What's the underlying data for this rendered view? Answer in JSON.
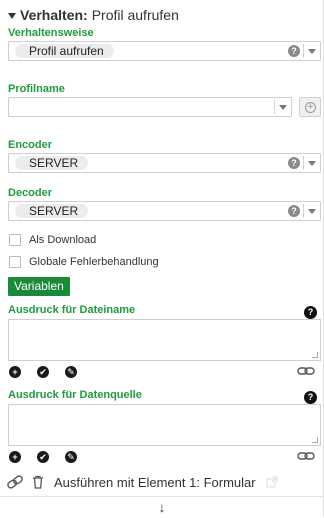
{
  "header": {
    "prefix": "Verhalten:",
    "title": "Profil aufrufen"
  },
  "fields": {
    "verhaltensweise": {
      "label": "Verhaltensweise",
      "value": "Profil aufrufen"
    },
    "profilname": {
      "label": "Profilname",
      "value": ""
    },
    "encoder": {
      "label": "Encoder",
      "value": "SERVER"
    },
    "decoder": {
      "label": "Decoder",
      "value": "SERVER"
    }
  },
  "checkboxes": [
    {
      "label": "Als Download",
      "checked": false
    },
    {
      "label": "Globale Fehlerbehandlung",
      "checked": false
    }
  ],
  "variables_button": "Variablen",
  "expressions": [
    {
      "label": "Ausdruck für Dateiname",
      "value": ""
    },
    {
      "label": "Ausdruck für Datenquelle",
      "value": ""
    }
  ],
  "icons": {
    "help": "?",
    "add": "+",
    "check": "✔",
    "edit": "✎",
    "link": "link-icon",
    "trash": "trash-icon",
    "expand": "↓"
  },
  "footer": {
    "text": "Ausführen mit Element 1: Formular"
  },
  "colors": {
    "label_green": "#1f9a3f",
    "button_green": "#1a8a3a"
  }
}
